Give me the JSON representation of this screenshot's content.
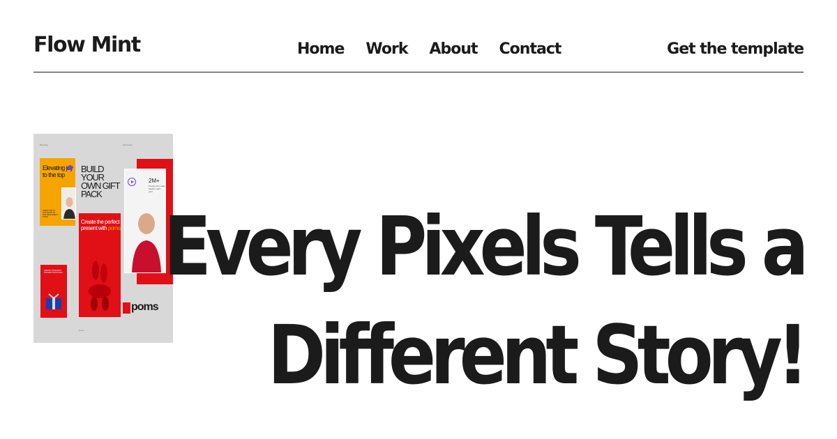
{
  "header": {
    "logo": "Flow Mint",
    "nav": [
      {
        "label": "Home"
      },
      {
        "label": "Work"
      },
      {
        "label": "About"
      },
      {
        "label": "Contact"
      }
    ],
    "cta_label": "Get the template"
  },
  "hero": {
    "headline_line1": "Every Pixels Tells a",
    "headline_line2": "Different Story!"
  },
  "thumbnail": {
    "card1_text": "Elevating joy to the top",
    "card1_fine": "GREAT FOR IN THE TRUTH TO TOP MAKE GREAT THING",
    "card2_title": "BUILD YOUR OWN GIFT PACK",
    "card3_text": "Create the perfect present with",
    "card3_brand": "poms",
    "card4_stat": "2M+",
    "card4_sub": "People who make happier each year",
    "card5_text": "CREATE YOUR BEST PRESENT WITH POMS",
    "brand": "poms"
  },
  "colors": {
    "text": "#1b1b1b",
    "accent_red": "#e01016",
    "accent_yellow": "#f5a400",
    "accent_purple": "#6a3ff0",
    "thumb_bg": "#d8d8d8"
  }
}
